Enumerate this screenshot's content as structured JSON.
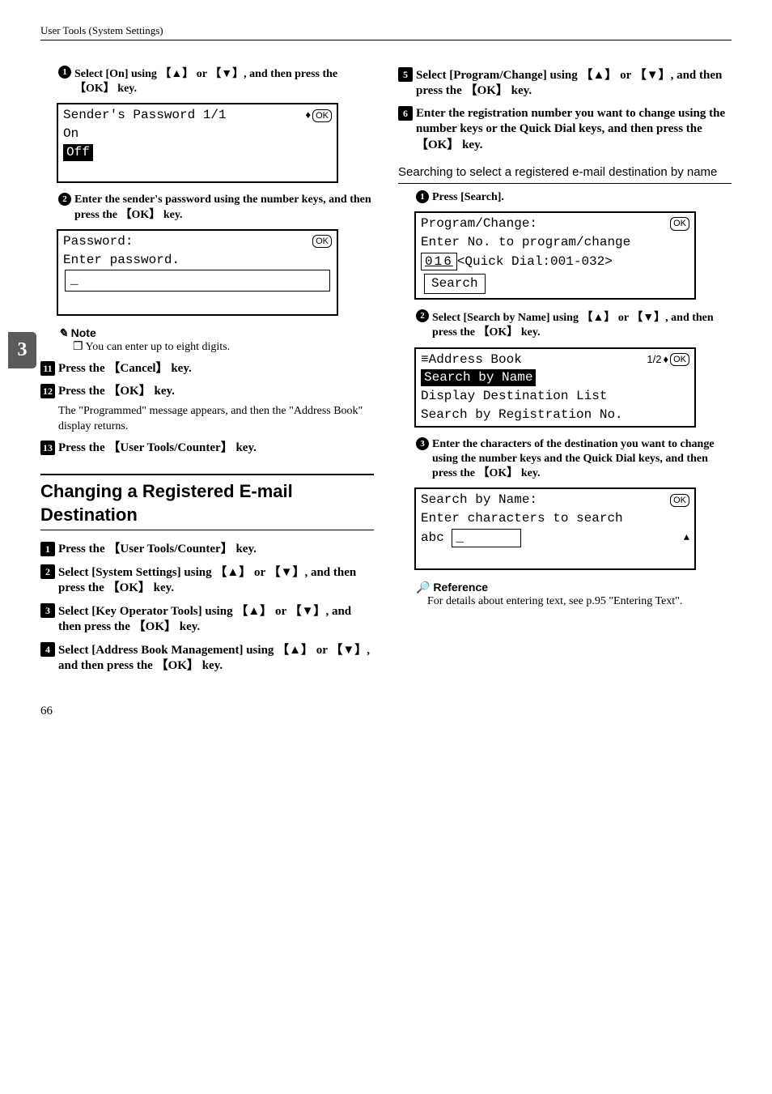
{
  "header": "User Tools (System Settings)",
  "sidebar_tab": "3",
  "page_number": "66",
  "left": {
    "sub1": {
      "num": "1",
      "text_parts": [
        "Select ",
        "[On]",
        " using ",
        "【▲】",
        " or ",
        "【▼】",
        ", and then press the ",
        "【OK】",
        " key."
      ]
    },
    "lcd1": {
      "title": "Sender's Password 1/1",
      "ok": "OK",
      "row1": "On",
      "row2_hi": "Off"
    },
    "sub2": {
      "num": "2",
      "text_parts": [
        "Enter the sender's password using the number keys, and then press the ",
        "【OK】",
        " key."
      ]
    },
    "lcd2": {
      "title": "Password:",
      "ok": "OK",
      "row1": "Enter password.",
      "input": "_"
    },
    "note": {
      "head": "Note",
      "body": "You can enter up to eight digits."
    },
    "step11": {
      "num": "11",
      "text_parts": [
        "Press the ",
        "【Cancel】",
        " key."
      ]
    },
    "step12": {
      "num": "12",
      "text_parts": [
        "Press the ",
        "【OK】",
        " key."
      ],
      "body": "The \"Programmed\" message appears, and then the \"Address Book\" display returns."
    },
    "step13": {
      "num": "13",
      "text_parts": [
        "Press the ",
        "【User Tools/Counter】",
        " key."
      ]
    },
    "section_title": "Changing a Registered E-mail Destination",
    "s1": {
      "num": "1",
      "text_parts": [
        "Press the ",
        "【User Tools/Counter】",
        " key."
      ]
    },
    "s2": {
      "num": "2",
      "text_parts": [
        "Select ",
        "[System Settings]",
        " using ",
        "【▲】",
        " or ",
        "【▼】",
        ", and then press the ",
        "【OK】",
        " key."
      ]
    },
    "s3": {
      "num": "3",
      "text_parts": [
        "Select ",
        "[Key Operator Tools]",
        " using ",
        "【▲】",
        " or ",
        "【▼】",
        ", and then press the ",
        "【OK】",
        " key."
      ]
    },
    "s4": {
      "num": "4",
      "text_parts": [
        "Select ",
        "[Address Book Management]",
        " using ",
        "【▲】",
        " or ",
        "【▼】",
        ", and then press the ",
        "【OK】",
        " key."
      ]
    }
  },
  "right": {
    "s5": {
      "num": "5",
      "text_parts": [
        " Select ",
        "[Program/Change]",
        " using ",
        "【▲】",
        " or ",
        "【▼】",
        ", and then press the ",
        "【OK】",
        " key."
      ]
    },
    "s6": {
      "num": "6",
      "text_parts": [
        "Enter the registration number you want to change using the number keys or the Quick Dial keys, and then press the ",
        "【OK】",
        " key."
      ]
    },
    "subsection": "Searching to select a registered e-mail destination by name",
    "r1": {
      "num": "1",
      "text_parts": [
        "Press ",
        "[Search]",
        "."
      ]
    },
    "lcd3": {
      "title": "Program/Change:",
      "ok": "OK",
      "row1": "Enter No. to program/change",
      "reg": "016",
      "reg_tail": "<Quick Dial:001-032>",
      "search": "Search"
    },
    "r2": {
      "num": "2",
      "text_parts": [
        "Select ",
        "[Search by Name]",
        " using ",
        "【▲】",
        " or ",
        "【▼】",
        ", and then press the ",
        "【OK】",
        " key."
      ]
    },
    "lcd4": {
      "title_icon": "≡",
      "title": "Address Book",
      "page": "1/2",
      "ok": "OK",
      "hi": "Search by Name",
      "row2": "Display Destination List",
      "row3": "Search by Registration No."
    },
    "r3": {
      "num": "3",
      "text_parts": [
        "Enter the characters of the destination you want to change using the number keys and the Quick Dial keys, and then press the ",
        "【OK】",
        " key."
      ]
    },
    "lcd5": {
      "title": "Search by Name:",
      "ok": "OK",
      "row1": "Enter characters to search",
      "mode": "abc",
      "input": "_",
      "shift": "▲"
    },
    "reference": {
      "head": "Reference",
      "body": "For details about entering text, see p.95 \"Entering Text\"."
    }
  }
}
